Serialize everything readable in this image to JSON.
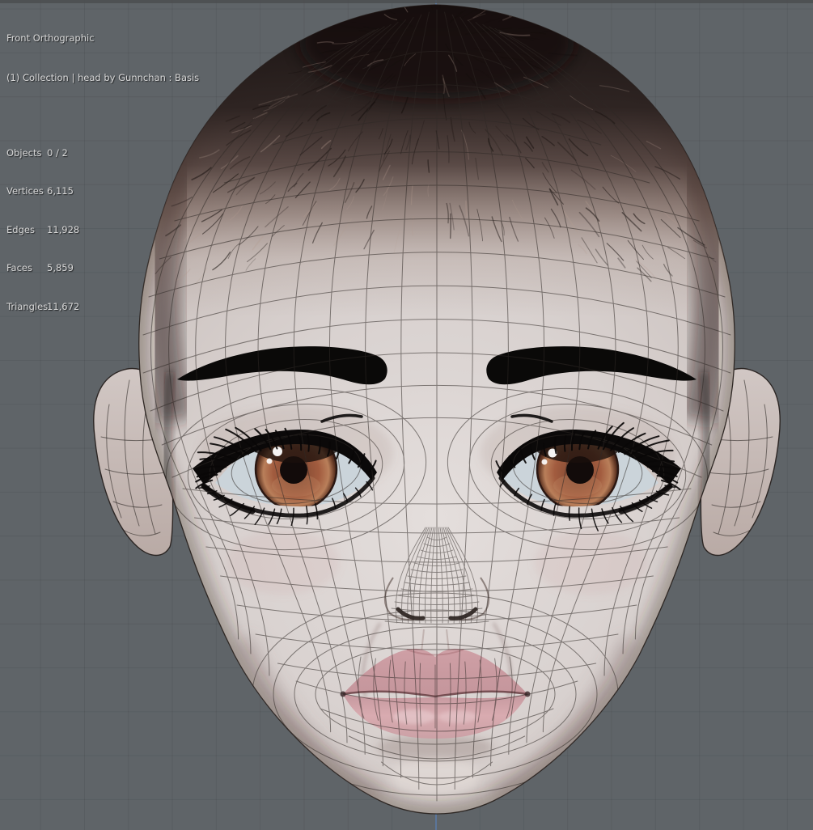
{
  "viewport": {
    "view_label": "Front Orthographic",
    "context_label": "(1) Collection | head by Gunnchan : Basis",
    "stats": [
      {
        "label": "Objects",
        "value": "0 / 2"
      },
      {
        "label": "Vertices",
        "value": "6,115"
      },
      {
        "label": "Edges",
        "value": "11,928"
      },
      {
        "label": "Faces",
        "value": "5,859"
      },
      {
        "label": "Triangles",
        "value": "11,672"
      }
    ]
  },
  "colors": {
    "background": "#5f6468",
    "grid_line": "rgba(0,0,0,0.07)",
    "axis_z": "#5b80b2",
    "top_edge": "#4b4e50",
    "overlay_text": "#d8d8d8",
    "skin_light": "#e4dedc",
    "skin": "#d9d2d0",
    "skin_mid": "#cec5c2",
    "skin_shadow": "#a5968f",
    "hair_dark": "#191312",
    "hair_mid": "#453430",
    "hair_fade": "#99837a",
    "wire": "#2f2926",
    "outline": "#2c2624",
    "brow": "#0a0908",
    "liner": "#0b0909",
    "lash": "#0a0808",
    "sclera": "#cbd4da",
    "iris_dark": "#3a2018",
    "iris_mid": "#a25c3f",
    "iris_light": "#c08a67",
    "pupil": "#120b0a",
    "highlight": "#ffffff",
    "lip_upper": "#c4959b",
    "lip_lower": "#d9abb0",
    "lip_line": "#6e4549",
    "ear_top": "#d2c8c5",
    "ear_bottom": "#b9aaa5"
  }
}
